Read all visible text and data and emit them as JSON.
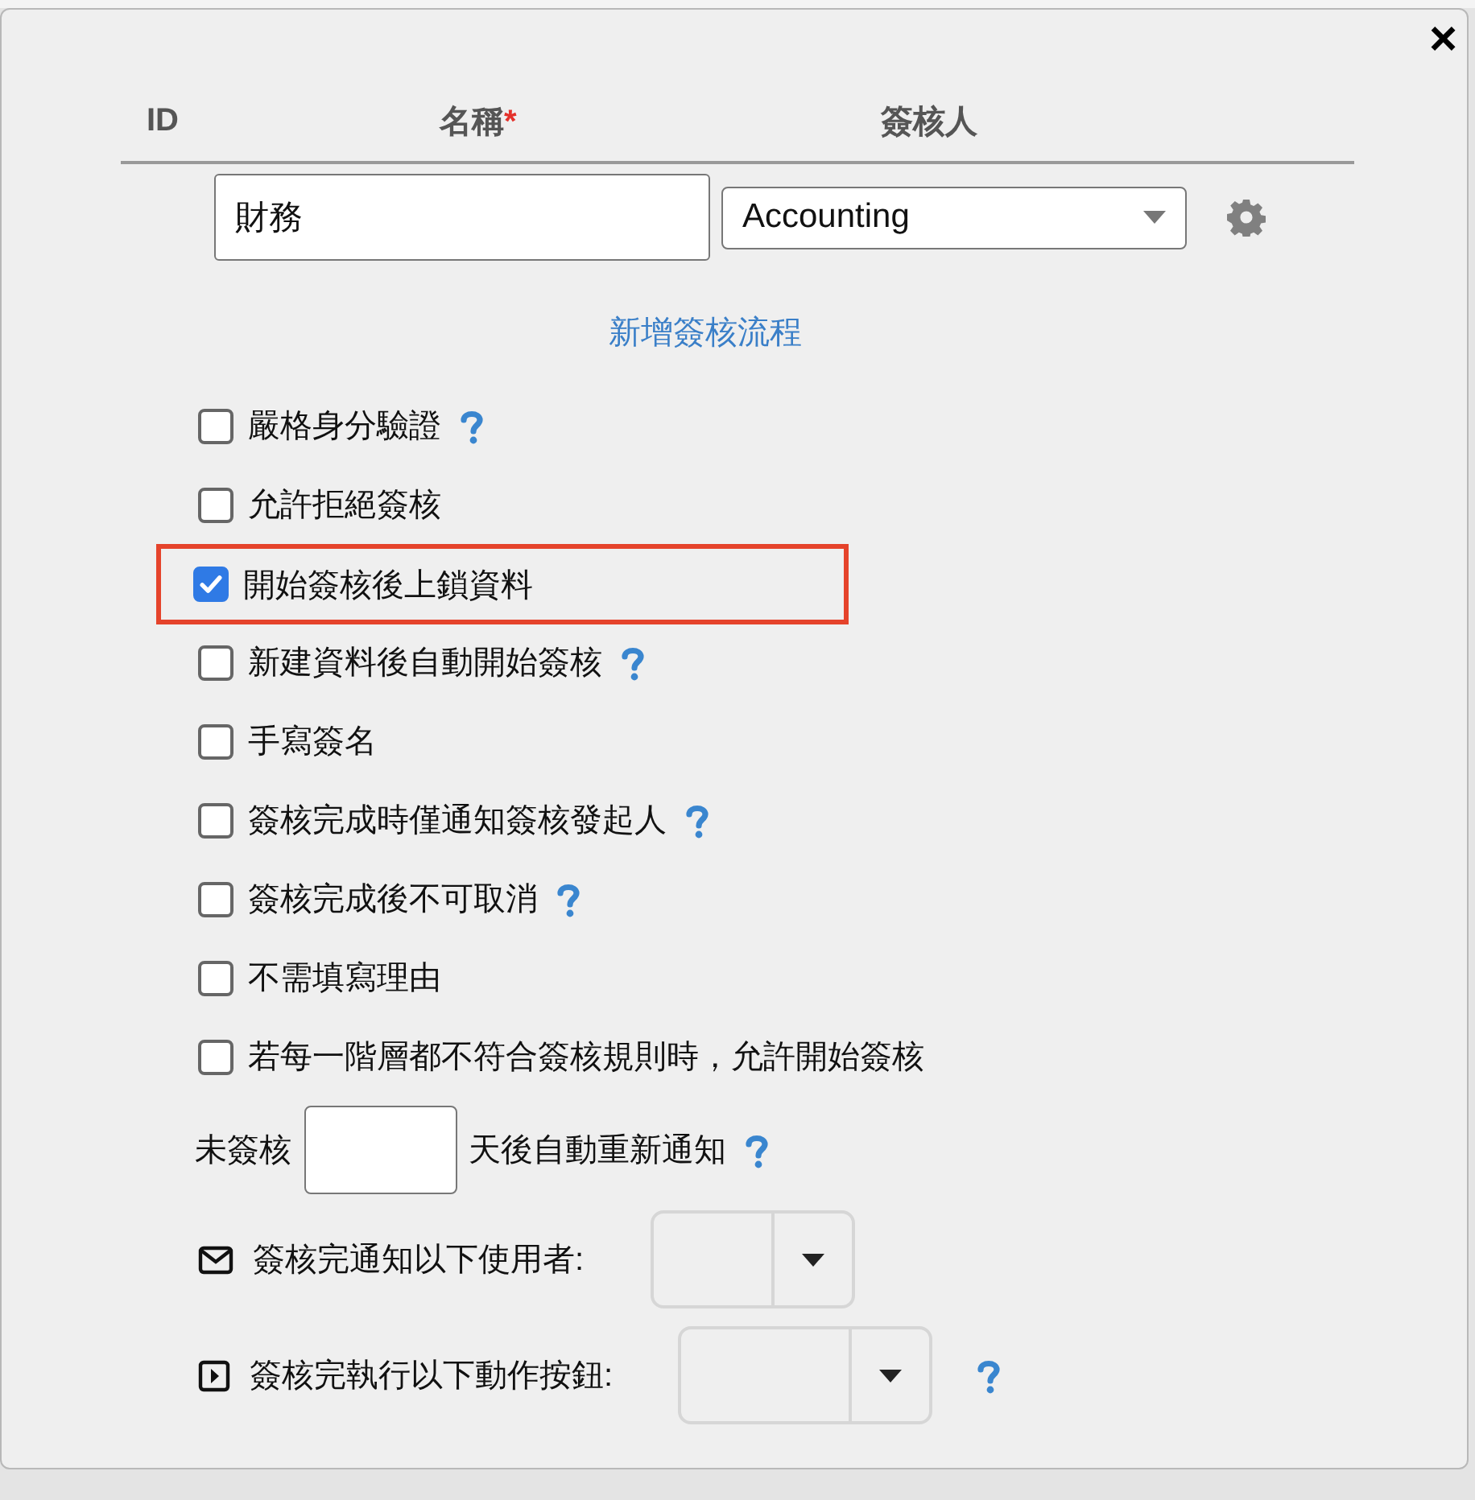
{
  "close_label": "×",
  "columns": [
    {
      "kind": "id",
      "label": "ID"
    },
    {
      "kind": "name",
      "label": "名稱",
      "required_mark": "*"
    },
    {
      "kind": "approver",
      "label": "簽核人"
    }
  ],
  "row": {
    "name_value": "財務",
    "approver_value": "Accounting"
  },
  "add_link": "新增簽核流程",
  "options": [
    {
      "label": "嚴格身分驗證",
      "checked": false,
      "help": true,
      "highlighted": false
    },
    {
      "label": "允許拒絕簽核",
      "checked": false,
      "help": false,
      "highlighted": false
    },
    {
      "label": "開始簽核後上鎖資料",
      "checked": true,
      "help": false,
      "highlighted": true
    },
    {
      "label": "新建資料後自動開始簽核",
      "checked": false,
      "help": true,
      "highlighted": false
    },
    {
      "label": "手寫簽名",
      "checked": false,
      "help": false,
      "highlighted": false
    },
    {
      "label": "簽核完成時僅通知簽核發起人",
      "checked": false,
      "help": true,
      "highlighted": false
    },
    {
      "label": "簽核完成後不可取消",
      "checked": false,
      "help": true,
      "highlighted": false
    },
    {
      "label": "不需填寫理由",
      "checked": false,
      "help": false,
      "highlighted": false
    },
    {
      "label": "若每一階層都不符合簽核規則時，允許開始簽核",
      "checked": false,
      "help": false,
      "highlighted": false
    }
  ],
  "reminder": {
    "before": "未簽核",
    "after": "天後自動重新通知",
    "help": true
  },
  "pickers": [
    {
      "kind": "mail",
      "label": "簽核完通知以下使用者:",
      "help": false
    },
    {
      "kind": "action",
      "label": "簽核完執行以下動作按鈕:",
      "help": true
    }
  ]
}
